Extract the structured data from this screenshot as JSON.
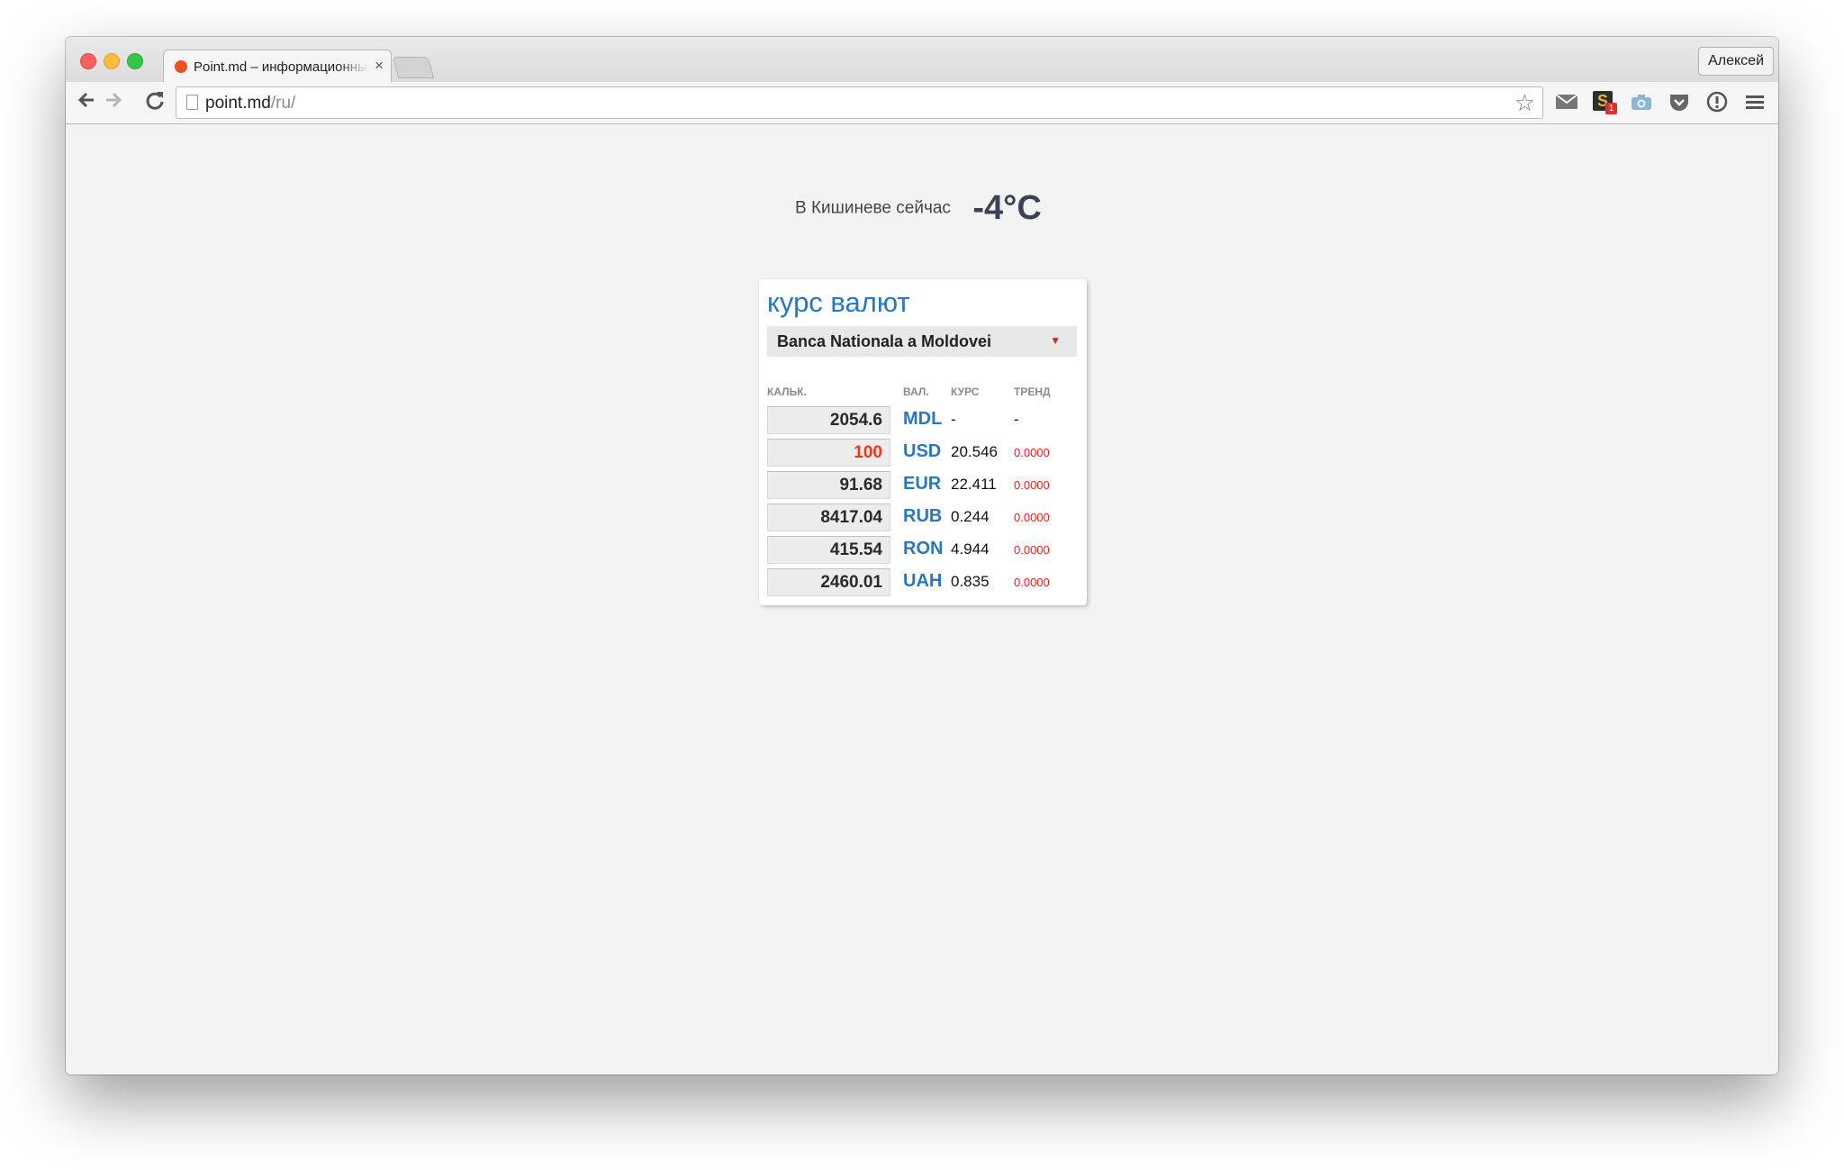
{
  "browser": {
    "tab_title": "Point.md – информационный портал",
    "tab_close": "×",
    "profile_name": "Алексей",
    "url_domain": "point.md",
    "url_path": "/ru/",
    "icons": [
      "back-arrow-icon",
      "forward-arrow-icon",
      "reload-icon",
      "page-icon",
      "bookmark-star-icon",
      "mail-icon",
      "s-extension-icon",
      "camera-icon",
      "pocket-icon",
      "info-icon",
      "menu-icon"
    ],
    "extension_badge": "1",
    "extension_letter": "S"
  },
  "weather": {
    "label": "В Кишиневе сейчас",
    "temperature": "-4°C"
  },
  "currency_widget": {
    "title": "курс валют",
    "bank": "Banca Nationala a Moldovei",
    "headers": {
      "calc": "КАЛЬК.",
      "currency": "ВАЛ.",
      "rate": "КУРС",
      "trend": "ТРЕНД"
    },
    "rows": [
      {
        "calc": "2054.6",
        "code": "MDL",
        "rate": "-",
        "trend": "-"
      },
      {
        "calc": "100",
        "code": "USD",
        "rate": "20.546",
        "trend": "0.0000"
      },
      {
        "calc": "91.68",
        "code": "EUR",
        "rate": "22.411",
        "trend": "0.0000"
      },
      {
        "calc": "8417.04",
        "code": "RUB",
        "rate": "0.244",
        "trend": "0.0000"
      },
      {
        "calc": "415.54",
        "code": "RON",
        "rate": "4.944",
        "trend": "0.0000"
      },
      {
        "calc": "2460.01",
        "code": "UAH",
        "rate": "0.835",
        "trend": "0.0000"
      }
    ],
    "active_row": "USD",
    "colors": {
      "title": "#2a77c0",
      "active_value": "#e2391f",
      "trend": "#e2231b"
    }
  }
}
